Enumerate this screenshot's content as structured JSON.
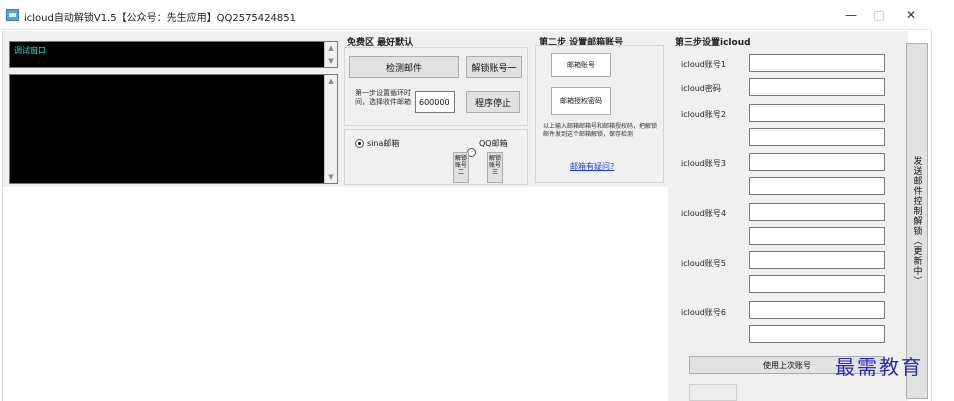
{
  "window": {
    "title": "icloud自动解锁V1.5【公众号：先生应用】QQ2575424851",
    "minimize": "—",
    "maximize": "□",
    "close": "✕"
  },
  "console": {
    "top_text": "调试窗口"
  },
  "free_zone": {
    "title": "免费区 最好默认",
    "detect_button": "检测邮件",
    "unlock_one_button": "解锁账号一",
    "interval_label": "第一步设置循环时间，选择收件邮箱",
    "interval_value": "600000",
    "stop_button": "程序停止",
    "radio_sina": "sina邮箱",
    "radio_qq": "QQ邮箱",
    "unlock2_button": "解锁账号二",
    "unlock3_button": "解锁账号三"
  },
  "step2": {
    "title": "第二步 设置邮箱账号",
    "email_account_button": "邮箱账号",
    "email_auth_button": "邮箱授权密码",
    "note": "以上输入邮箱邮箱号和邮箱授权码，把解锁邮件发到这个邮箱解锁，保存检测",
    "help_link": "邮箱有疑问?"
  },
  "step3": {
    "title": "第三步设置icloud",
    "account1_label": "icloud账号1",
    "password_label": "icloud密码",
    "account2_label": "icloud账号2",
    "account3_label": "icloud账号3",
    "account4_label": "icloud账号4",
    "account5_label": "icloud账号5",
    "account6_label": "icloud账号6",
    "use_last_button": "使用上次账号"
  },
  "side": {
    "vertical_button": "发送邮件控制解锁（更新中）"
  },
  "watermark": "最需教育"
}
